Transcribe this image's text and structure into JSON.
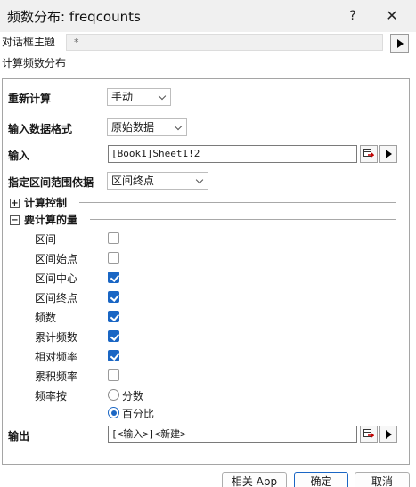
{
  "window": {
    "title": "频数分布: freqcounts",
    "help": "?",
    "close": "✕"
  },
  "theme": {
    "label": "对话框主题",
    "value": "*"
  },
  "description": "计算频数分布",
  "form": {
    "recalc": {
      "label": "重新计算",
      "value": "手动"
    },
    "input_format": {
      "label": "输入数据格式",
      "value": "原始数据"
    },
    "input": {
      "label": "输入",
      "value": "[Book1]Sheet1!2"
    },
    "range_basis": {
      "label": "指定区间范围依据",
      "value": "区间终点"
    },
    "compute_control": {
      "label": "计算控制",
      "toggle": "+"
    },
    "quantities": {
      "label": "要计算的量",
      "toggle": "−",
      "items": [
        {
          "label": "区间",
          "checked": false
        },
        {
          "label": "区间始点",
          "checked": false
        },
        {
          "label": "区间中心",
          "checked": true
        },
        {
          "label": "区间终点",
          "checked": true
        },
        {
          "label": "频数",
          "checked": true
        },
        {
          "label": "累计频数",
          "checked": true
        },
        {
          "label": "相对频率",
          "checked": true
        },
        {
          "label": "累积频率",
          "checked": false
        }
      ],
      "freq_by": {
        "label": "频率按",
        "options": [
          "分数",
          "百分比"
        ],
        "selected": "百分比"
      }
    },
    "output": {
      "label": "输出",
      "value": "[<输入>]<新建>"
    }
  },
  "buttons": {
    "related_app": "相关 App",
    "ok": "确定",
    "cancel": "取消"
  },
  "colors": {
    "accent": "#1a66c4"
  }
}
